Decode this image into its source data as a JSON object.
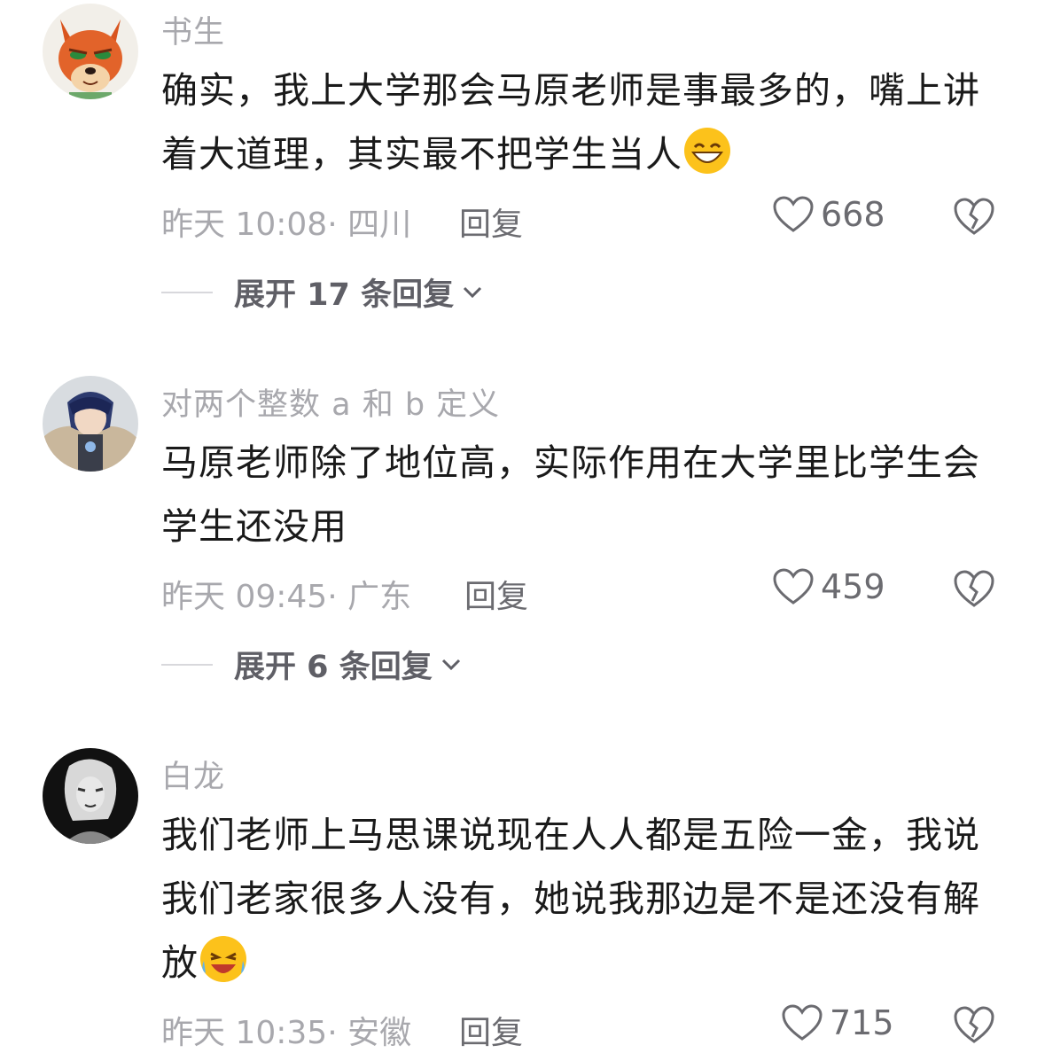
{
  "comments": [
    {
      "username": "书生",
      "text": "确实，我上大学那会马原老师是事最多的，嘴上讲着大道理，其实最不把学生当人",
      "emoji": "grin-emoji",
      "time": "昨天 10:08",
      "location": "四川",
      "reply_label": "回复",
      "likes": "668",
      "expand_label": "展开 17 条回复",
      "avatar": "fox-avatar"
    },
    {
      "username": "对两个整数 a 和 b 定义",
      "text": "马原老师除了地位高，实际作用在大学里比学生会学生还没用",
      "time": "昨天 09:45",
      "location": "广东",
      "reply_label": "回复",
      "likes": "459",
      "expand_label": "展开 6 条回复",
      "avatar": "anime-avatar"
    },
    {
      "username": "白龙",
      "text": "我们老师上马思课说现在人人都是五险一金，我说我们老家很多人没有，她说我那边是不是还没有解放",
      "emoji": "laugh-cry-emoji",
      "time": "昨天 10:35",
      "location": "安徽",
      "reply_label": "回复",
      "likes": "715",
      "avatar": "dark-portrait-avatar"
    }
  ],
  "colors": {
    "text": "#1a1a1a",
    "muted": "#a8a8ad",
    "action": "#6b6b70"
  }
}
